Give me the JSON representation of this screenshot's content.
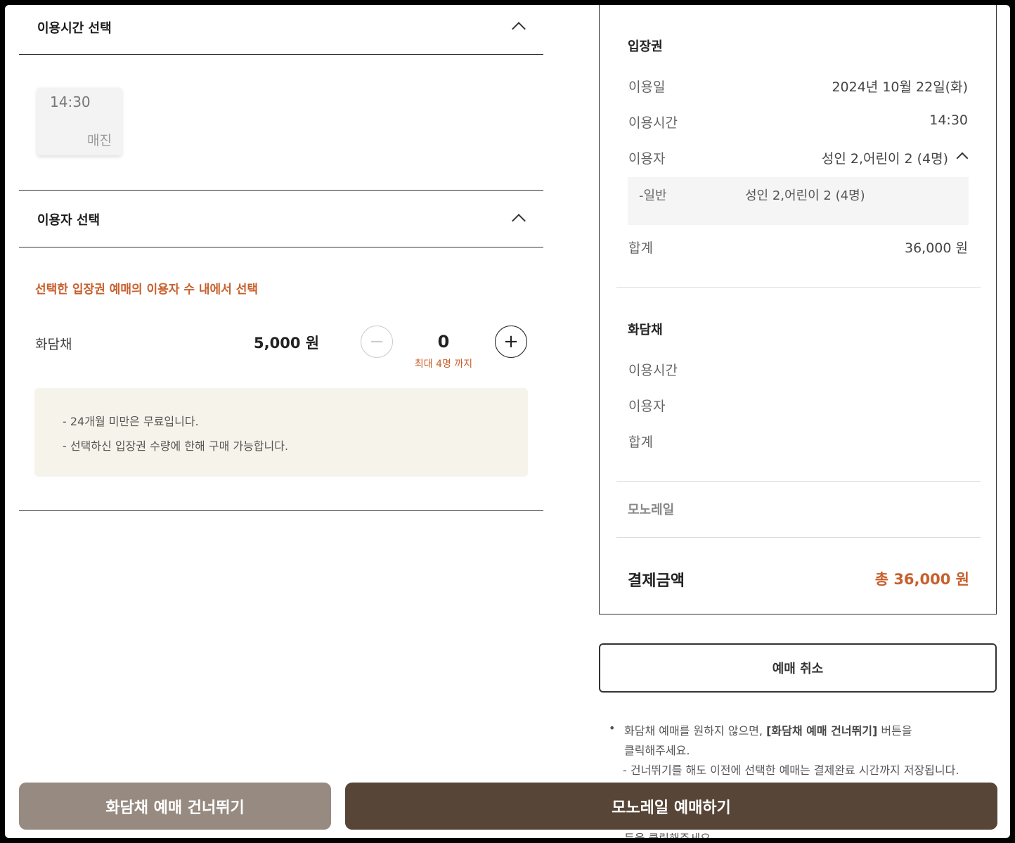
{
  "time_section": {
    "title": "이용시간 선택",
    "slot_time": "14:30",
    "slot_status": "매진"
  },
  "user_section": {
    "title": "이용자 선택",
    "notice": "선택한 입장권 예매의 이용자 수 내에서 선택",
    "item_name": "화담채",
    "item_price": "5,000 원",
    "quantity": "0",
    "max_label": "최대 4명 까지",
    "minus_icon": "−",
    "plus_icon": "+",
    "notes": [
      "-  24개월 미만은 무료입니다.",
      "-  선택하신 입장권 수량에 한해 구매 가능합니다."
    ]
  },
  "summary": {
    "ticket": {
      "title": "입장권",
      "date_label": "이용일",
      "date_value": "2024년 10월 22일(화)",
      "time_label": "이용시간",
      "time_value": "14:30",
      "users_label": "이용자",
      "users_value": "성인 2,어린이 2 (4명)",
      "sub_label": "-일반",
      "sub_value": "성인 2,어린이 2 (4명)",
      "total_label": "합계",
      "total_value": "36,000 원"
    },
    "hwadamchae": {
      "title": "화담채",
      "time_label": "이용시간",
      "users_label": "이용자",
      "total_label": "합계"
    },
    "monorail": {
      "title": "모노레일"
    },
    "payment_label": "결제금액",
    "payment_value": "총 36,000 원"
  },
  "cancel_button": "예매 취소",
  "info": {
    "bullet": "•",
    "line1_pre": "화담채 예매를 원하지 않으면, ",
    "line1_bold": "[화담채 예매 건너뛰기]",
    "line1_post": " 버튼을",
    "line2": "클릭해주세요.",
    "line3": "- 건너뛰기를 해도 이전에 선택한 예매는 결제완료 시간까지 저장됩니다.",
    "line5": "등을 클릭해주세요"
  },
  "bottom": {
    "skip_label": "화담채 예매 건너뛰기",
    "monorail_label": "모노레일 예매하기"
  },
  "colors": {
    "accent_orange": "#c8602d",
    "skip_button": "#978a80",
    "monorail_button": "#574537",
    "note_bg": "#f6f3ea"
  }
}
